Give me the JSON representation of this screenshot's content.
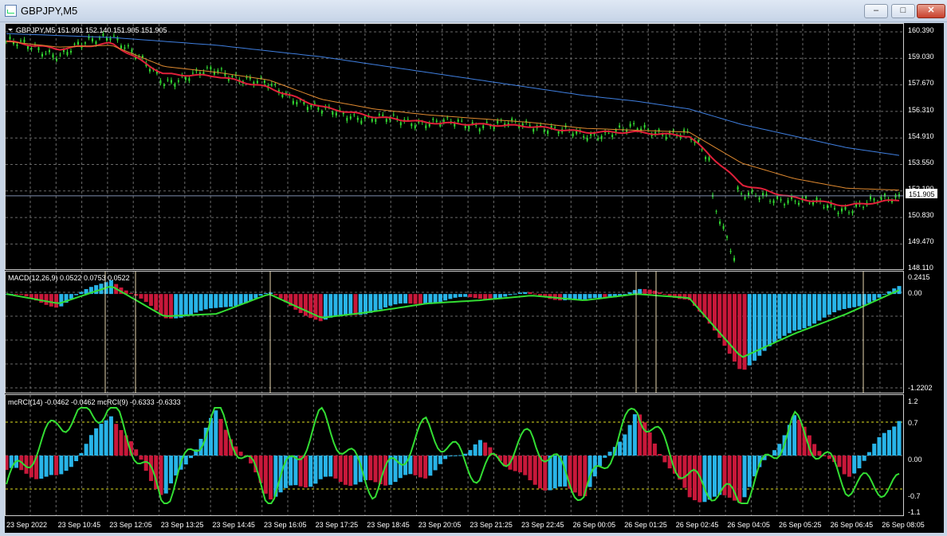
{
  "window": {
    "title": "GBPJPY,M5",
    "minimize_glyph": "–",
    "maximize_glyph": "□",
    "close_glyph": "✕"
  },
  "main_chart": {
    "header": "GBPJPY,M5  151.991 152.140 151.905 151.905",
    "price_levels": [
      "160.390",
      "159.030",
      "157.670",
      "156.310",
      "154.910",
      "153.550",
      "152.190",
      "150.830",
      "149.470",
      "148.110"
    ],
    "current_price": "151.905",
    "current_price_value": 151.905
  },
  "macd": {
    "header": "MACD(12,26,9) 0.0522 0.0753 0.0522",
    "levels": [
      "0.2415",
      "0.00",
      "-1.2202"
    ]
  },
  "rci": {
    "header": "mcRCI(14) -0.0462 -0.0462  mcRCI(9) -0.6333 -0.6333",
    "levels": [
      "1.2",
      "0.7",
      "0.00",
      "-0.7",
      "-1.1"
    ]
  },
  "time_labels": [
    "23 Sep 2022",
    "23 Sep 10:45",
    "23 Sep 12:05",
    "23 Sep 13:25",
    "23 Sep 14:45",
    "23 Sep 16:05",
    "23 Sep 17:25",
    "23 Sep 18:45",
    "23 Sep 20:05",
    "23 Sep 21:25",
    "23 Sep 22:45",
    "26 Sep 00:05",
    "26 Sep 01:25",
    "26 Sep 02:45",
    "26 Sep 04:05",
    "26 Sep 05:25",
    "26 Sep 06:45",
    "26 Sep 08:05"
  ],
  "colors": {
    "background": "#000000",
    "grid": "#6a6a6a",
    "candles": "#33dd33",
    "ma_fast": "#e0203a",
    "ma_mid": "#e08a30",
    "ma_slow": "#3f7fe0",
    "hist_up": "#28b4e8",
    "hist_down": "#c8183a",
    "signal": "#33dd33",
    "level_line": "#e0e020",
    "axis_text": "#ffffff"
  },
  "chart_data": [
    {
      "type": "line",
      "title": "GBPJPY,M5",
      "description_series": [
        "price",
        "ma_fast",
        "ma_mid",
        "ma_slow"
      ],
      "x": [
        "23 Sep 2022",
        "23 Sep 10:45",
        "23 Sep 12:05",
        "23 Sep 13:25",
        "23 Sep 14:45",
        "23 Sep 16:05",
        "23 Sep 17:25",
        "23 Sep 18:45",
        "23 Sep 20:05",
        "23 Sep 21:25",
        "23 Sep 22:45",
        "26 Sep 00:05",
        "26 Sep 01:25",
        "26 Sep 02:45",
        "26 Sep 04:05",
        "26 Sep 05:25",
        "26 Sep 06:45",
        "26 Sep 08:05"
      ],
      "series": [
        {
          "values": [
            159.9,
            159.2,
            160.3,
            157.8,
            158.4,
            157.6,
            156.3,
            155.9,
            155.7,
            155.6,
            155.6,
            155.0,
            155.4,
            155.0,
            151.9,
            151.7,
            151.2,
            151.9
          ]
        },
        {
          "values": [
            159.9,
            159.5,
            159.8,
            158.2,
            158.1,
            157.5,
            156.5,
            156.0,
            155.7,
            155.6,
            155.5,
            155.2,
            155.2,
            155.0,
            152.5,
            151.8,
            151.4,
            151.7
          ]
        },
        {
          "values": [
            159.9,
            159.6,
            159.7,
            158.6,
            158.3,
            157.9,
            156.9,
            156.4,
            156.1,
            155.9,
            155.7,
            155.4,
            155.3,
            155.2,
            153.6,
            152.8,
            152.3,
            152.2
          ]
        },
        {
          "values": [
            160.3,
            160.2,
            160.1,
            159.9,
            159.7,
            159.4,
            159.1,
            158.7,
            158.3,
            157.9,
            157.5,
            157.1,
            156.8,
            156.4,
            155.6,
            155.0,
            154.4,
            154.0
          ]
        }
      ],
      "ylim": [
        148.11,
        160.39
      ]
    },
    {
      "type": "bar",
      "title": "MACD(12,26,9)",
      "x": [
        "23 Sep 2022",
        "23 Sep 10:45",
        "23 Sep 12:05",
        "23 Sep 13:25",
        "23 Sep 14:45",
        "23 Sep 16:05",
        "23 Sep 17:25",
        "23 Sep 18:45",
        "23 Sep 20:05",
        "23 Sep 21:25",
        "23 Sep 22:45",
        "26 Sep 00:05",
        "26 Sep 01:25",
        "26 Sep 02:45",
        "26 Sep 04:05",
        "26 Sep 05:25",
        "26 Sep 06:45",
        "26 Sep 08:05"
      ],
      "series": [
        {
          "values": [
            0.0,
            -0.15,
            0.2,
            -0.3,
            -0.2,
            0.0,
            -0.35,
            -0.2,
            -0.1,
            -0.05,
            0.0,
            -0.1,
            0.05,
            -0.05,
            -0.95,
            -0.45,
            -0.2,
            0.07
          ]
        },
        {
          "values": [
            0.0,
            -0.12,
            0.1,
            -0.28,
            -0.25,
            0.0,
            -0.3,
            -0.22,
            -0.12,
            -0.08,
            -0.02,
            -0.08,
            0.0,
            -0.05,
            -0.8,
            -0.5,
            -0.25,
            0.05
          ]
        }
      ],
      "ylim": [
        -1.2202,
        0.2415
      ]
    },
    {
      "type": "line",
      "title": "mcRCI(14) / mcRCI(9)",
      "x": [
        "23 Sep 2022",
        "23 Sep 10:45",
        "23 Sep 12:05",
        "23 Sep 13:25",
        "23 Sep 14:45",
        "23 Sep 16:05",
        "23 Sep 17:25",
        "23 Sep 18:45",
        "23 Sep 20:05",
        "23 Sep 21:25",
        "23 Sep 22:45",
        "26 Sep 00:05",
        "26 Sep 01:25",
        "26 Sep 02:45",
        "26 Sep 04:05",
        "26 Sep 05:25",
        "26 Sep 06:45",
        "26 Sep 08:05"
      ],
      "series": [
        {
          "name": "mcRCI(14)",
          "values": [
            -0.3,
            -0.5,
            0.9,
            -0.9,
            0.9,
            -0.85,
            -0.5,
            -0.6,
            -0.4,
            0.3,
            -0.6,
            -0.8,
            0.9,
            -0.9,
            -0.9,
            0.8,
            -0.5,
            0.8
          ]
        },
        {
          "name": "mcRCI(9)",
          "values": [
            -0.6,
            0.7,
            1.0,
            -0.95,
            0.95,
            -0.9,
            0.8,
            -0.7,
            0.6,
            -0.4,
            0.4,
            -0.85,
            1.0,
            -0.5,
            -0.95,
            0.7,
            -0.6,
            -0.63
          ]
        }
      ],
      "ylim": [
        -1.1,
        1.2
      ]
    }
  ]
}
